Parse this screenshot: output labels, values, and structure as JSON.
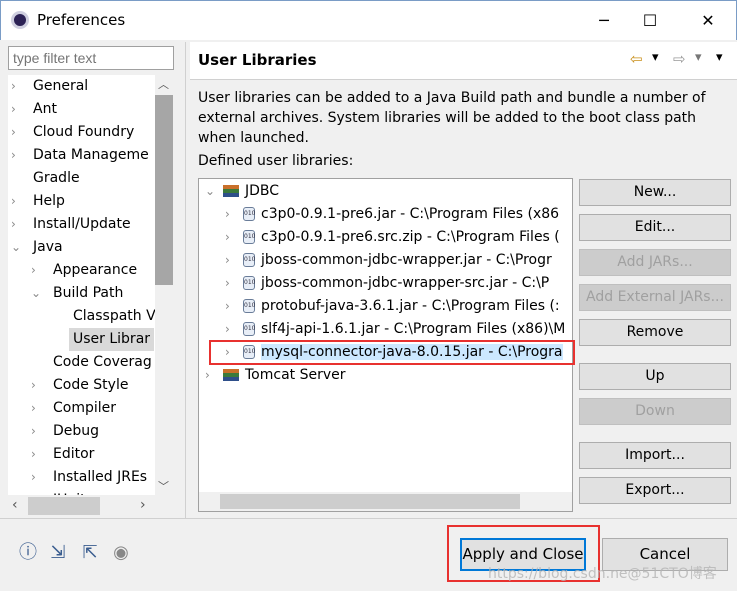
{
  "window": {
    "title": "Preferences",
    "minimize": "─",
    "maximize": "☐",
    "close": "✕"
  },
  "sidebar": {
    "filter_placeholder": "type filter text",
    "items": [
      {
        "label": "General",
        "arrow": "›",
        "depth": 0
      },
      {
        "label": "Ant",
        "arrow": "›",
        "depth": 0
      },
      {
        "label": "Cloud Foundry",
        "arrow": "›",
        "depth": 0
      },
      {
        "label": "Data Manageme",
        "arrow": "›",
        "depth": 0
      },
      {
        "label": "Gradle",
        "arrow": "",
        "depth": 0
      },
      {
        "label": "Help",
        "arrow": "›",
        "depth": 0
      },
      {
        "label": "Install/Update",
        "arrow": "›",
        "depth": 0
      },
      {
        "label": "Java",
        "arrow": "⌄",
        "depth": 0
      },
      {
        "label": "Appearance",
        "arrow": "›",
        "depth": 1
      },
      {
        "label": "Build Path",
        "arrow": "⌄",
        "depth": 1
      },
      {
        "label": "Classpath V",
        "arrow": "",
        "depth": 2
      },
      {
        "label": "User Librar",
        "arrow": "",
        "depth": 2,
        "selected": true
      },
      {
        "label": "Code Coverag",
        "arrow": "",
        "depth": 1
      },
      {
        "label": "Code Style",
        "arrow": "›",
        "depth": 1
      },
      {
        "label": "Compiler",
        "arrow": "›",
        "depth": 1
      },
      {
        "label": "Debug",
        "arrow": "›",
        "depth": 1
      },
      {
        "label": "Editor",
        "arrow": "›",
        "depth": 1
      },
      {
        "label": "Installed JREs",
        "arrow": "›",
        "depth": 1
      },
      {
        "label": "JUnit",
        "arrow": "›",
        "depth": 1
      }
    ]
  },
  "main": {
    "title": "User Libraries",
    "nav": {
      "back": "⇦",
      "forward": "⇨",
      "menu": "▾"
    },
    "description": "User libraries can be added to a Java Build path and bundle a number of external archives. System libraries will be added to the boot class path when launched.",
    "defined_label": "Defined user libraries:",
    "libraries": [
      {
        "label": "JDBC",
        "type": "library",
        "expanded": true,
        "children": [
          "c3p0-0.9.1-pre6.jar - C:\\Program Files (x86",
          "c3p0-0.9.1-pre6.src.zip - C:\\Program Files (",
          "jboss-common-jdbc-wrapper.jar - C:\\Progr",
          "jboss-common-jdbc-wrapper-src.jar - C:\\P",
          "protobuf-java-3.6.1.jar - C:\\Program Files (:",
          "slf4j-api-1.6.1.jar - C:\\Program Files (x86)\\M",
          "mysql-connector-java-8.0.15.jar - C:\\Progra"
        ]
      },
      {
        "label": "Tomcat Server",
        "type": "library",
        "expanded": false
      }
    ],
    "selected_child": 6,
    "buttons": [
      {
        "label": "New...",
        "enabled": true
      },
      {
        "label": "Edit...",
        "enabled": true
      },
      {
        "label": "Add JARs...",
        "enabled": false
      },
      {
        "label": "Add External JARs...",
        "enabled": false
      },
      {
        "label": "Remove",
        "enabled": true
      },
      {
        "label": "Up",
        "enabled": true
      },
      {
        "label": "Down",
        "enabled": false
      },
      {
        "label": "Import...",
        "enabled": true
      },
      {
        "label": "Export...",
        "enabled": true
      }
    ]
  },
  "footer": {
    "icons": [
      "help-icon",
      "import-icon",
      "export-icon",
      "record-icon"
    ],
    "apply_close": "Apply and Close",
    "cancel": "Cancel",
    "watermark": "https://blog.csdn.ne@51CTO博客"
  },
  "colors": {
    "highlight": "#e8312f",
    "focus": "#0078d7",
    "selection": "#cce8ff"
  }
}
